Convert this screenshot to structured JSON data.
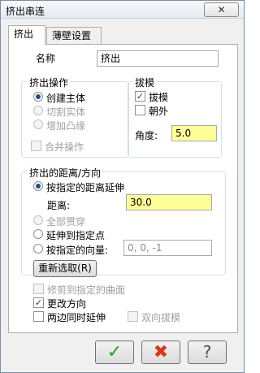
{
  "window": {
    "title": "挤出串连",
    "close_icon": "close-icon"
  },
  "tabs": [
    {
      "label": "挤出",
      "active": true
    },
    {
      "label": "薄壁设置",
      "active": false
    }
  ],
  "name": {
    "label": "名称",
    "value": "挤出"
  },
  "extrude_op": {
    "title": "挤出操作",
    "options": [
      {
        "label": "创建主体",
        "selected": true,
        "enabled": true
      },
      {
        "label": "切割实体",
        "selected": false,
        "enabled": false
      },
      {
        "label": "增加凸缘",
        "selected": false,
        "enabled": false
      }
    ],
    "merge": {
      "label": "合并操作",
      "checked": false,
      "enabled": false
    }
  },
  "draft": {
    "title": "拔模",
    "draft_check": {
      "label": "拔模",
      "checked": true
    },
    "outward_check": {
      "label": "朝外",
      "checked": false
    },
    "angle_label": "角度:",
    "angle_value": "5.0"
  },
  "distance": {
    "title": "挤出的距离/方向",
    "by_distance": {
      "label": "按指定的距离延伸",
      "selected": true
    },
    "dist_label": "距离:",
    "dist_value": "30.0",
    "through_all": {
      "label": "全部贯穿",
      "selected": false,
      "enabled": false
    },
    "to_point": {
      "label": "延伸到指定点",
      "selected": false
    },
    "by_vector": {
      "label": "按指定的向量:",
      "selected": false,
      "value": "0, 0, -1"
    },
    "reselect_label": "重新选取(R)"
  },
  "options": {
    "trim": {
      "label": "修剪到指定的曲面",
      "checked": false,
      "enabled": false
    },
    "reverse": {
      "label": "更改方向",
      "checked": true
    },
    "both_sides": {
      "label": "两边同时延伸",
      "checked": false
    },
    "two_way_draft": {
      "label": "双向拔模",
      "checked": false,
      "enabled": false
    }
  },
  "buttons": {
    "ok_icon": "check-icon",
    "cancel_icon": "x-icon",
    "help_icon": "help-icon"
  },
  "colors": {
    "highlight_input": "#ffff99",
    "ok": "#2a9d2a",
    "cancel": "#d9371c"
  }
}
